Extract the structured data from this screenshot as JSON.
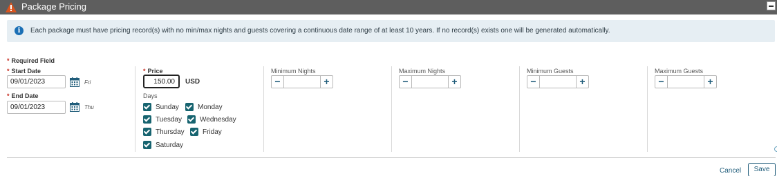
{
  "window": {
    "title": "Package Pricing"
  },
  "banner": {
    "text": "Each package must have pricing record(s) with no min/max nights and guests covering a continuous date range of at least 10 years. If no record(s) exists one will be generated automatically."
  },
  "form": {
    "required_legend": "Required Field",
    "required_marker": "*",
    "start_date": {
      "label": "Start Date",
      "value": "09/01/2023",
      "day": "Fri"
    },
    "end_date": {
      "label": "End Date",
      "value": "09/01/2023",
      "day": "Thu"
    },
    "price": {
      "label": "Price",
      "value": "150.00",
      "currency": "USD"
    },
    "days": {
      "label": "Days",
      "items": [
        {
          "label": "Sunday",
          "checked": true
        },
        {
          "label": "Monday",
          "checked": true
        },
        {
          "label": "Tuesday",
          "checked": true
        },
        {
          "label": "Wednesday",
          "checked": true
        },
        {
          "label": "Thursday",
          "checked": true
        },
        {
          "label": "Friday",
          "checked": true
        },
        {
          "label": "Saturday",
          "checked": true
        }
      ]
    },
    "min_nights": {
      "label": "Minimum Nights",
      "value": ""
    },
    "max_nights": {
      "label": "Maximum Nights",
      "value": ""
    },
    "min_guests": {
      "label": "Minimum Guests",
      "value": ""
    },
    "max_guests": {
      "label": "Maximum Guests",
      "value": ""
    }
  },
  "icons": {
    "warning": "warning-icon",
    "info": "info-icon",
    "calendar": "calendar-icon",
    "collapse": "collapse-icon"
  },
  "actions": {
    "cancel": "Cancel",
    "save": "Save"
  },
  "colors": {
    "titlebar": "#5e5e5e",
    "accent": "#176470",
    "link": "#1f5c7a",
    "required": "#c62b1e",
    "banner_bg": "#e6eef3"
  }
}
